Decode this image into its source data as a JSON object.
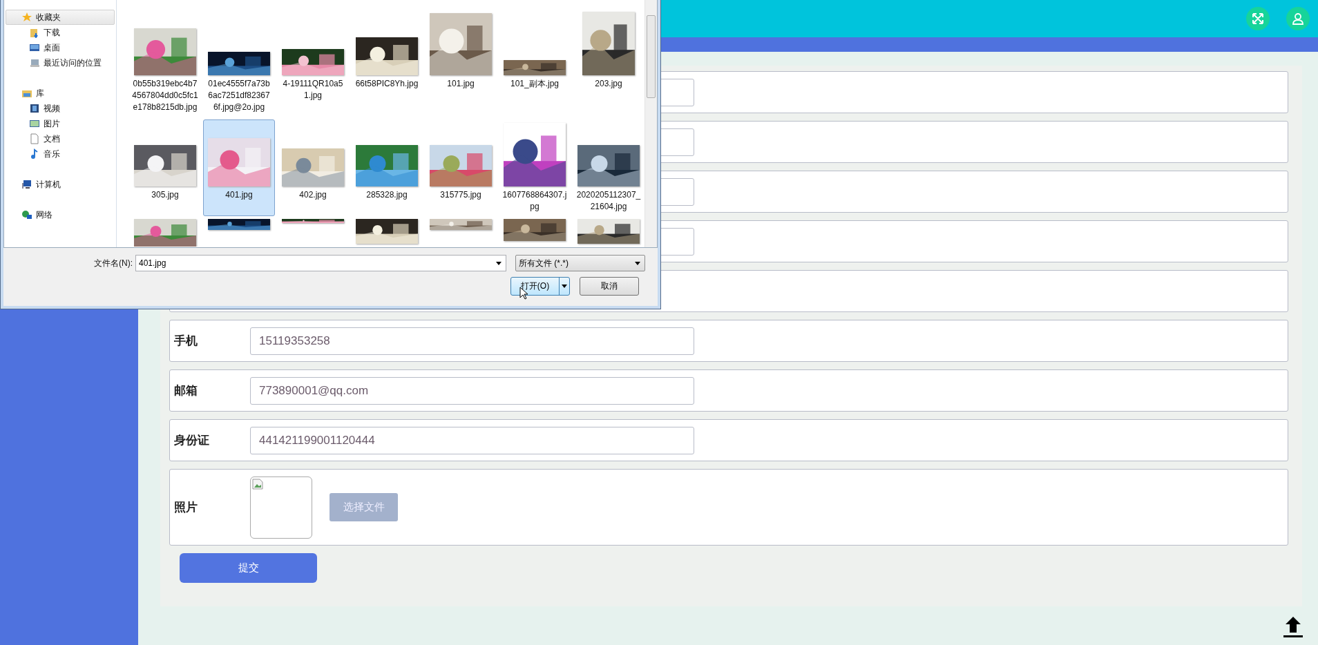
{
  "header": {
    "buttons": [
      {
        "kind": "fullscreen"
      },
      {
        "kind": "user"
      }
    ]
  },
  "form": {
    "rows": [
      {
        "kind": "input"
      },
      {
        "kind": "input"
      },
      {
        "kind": "input"
      },
      {
        "kind": "input"
      },
      {
        "kind": "blank"
      },
      {
        "kind": "input",
        "label": "手机",
        "value": "15119353258"
      },
      {
        "kind": "input",
        "label": "邮箱",
        "value": "773890001@qq.com"
      },
      {
        "kind": "input",
        "label": "身份证",
        "value": "441421199001120444"
      },
      {
        "label": "照片",
        "button": "选择文件"
      }
    ],
    "submit": "提交"
  },
  "dialog": {
    "nav": [
      {
        "label": "收藏夹",
        "selected": true,
        "children": [
          {
            "label": "下载",
            "selected": false
          },
          {
            "label": "桌面",
            "selected": false
          },
          {
            "label": "最近访问的位置",
            "selected": false
          }
        ]
      },
      {
        "label": "库",
        "selected": false,
        "children": [
          {
            "label": "视频",
            "selected": false
          },
          {
            "label": "图片",
            "selected": false
          },
          {
            "label": "文档",
            "selected": false
          },
          {
            "label": "音乐",
            "selected": false
          }
        ]
      },
      {
        "label": "计算机",
        "selected": false
      },
      {
        "label": "网络",
        "selected": false
      }
    ],
    "files": [
      {
        "name": "0b55b319ebc4b74567804dd0c5fc1e178b8215db.jpg",
        "selected": false
      },
      {
        "name": "01ec4555f7a73b6ac7251df823676f.jpg@2o.jpg",
        "selected": false
      },
      {
        "name": "4-19111QR10a51.jpg",
        "selected": false
      },
      {
        "name": "66t58PIC8Yh.jpg",
        "selected": false
      },
      {
        "name": "101.jpg",
        "selected": false
      },
      {
        "name": "101_副本.jpg",
        "selected": false
      },
      {
        "name": "203.jpg",
        "selected": false
      },
      {
        "name": "305.jpg",
        "selected": false
      },
      {
        "name": "401.jpg",
        "selected": true
      },
      {
        "name": "402.jpg",
        "selected": false
      },
      {
        "name": "285328.jpg",
        "selected": false
      },
      {
        "name": "315775.jpg",
        "selected": false
      },
      {
        "name": "1607768864307.jpg",
        "selected": false
      },
      {
        "name": "2020205112307_21604.jpg",
        "selected": false
      },
      {
        "kind": "picture"
      },
      {
        "kind": "picture"
      },
      {
        "kind": "picture"
      },
      {
        "kind": "picture"
      },
      {
        "kind": "picture"
      },
      {
        "kind": "picture"
      },
      {
        "kind": "picture"
      }
    ],
    "filename_label": "文件名(N):",
    "filename": "401.jpg",
    "filter": "所有文件 (*.*)",
    "open": "打开(O)",
    "cancel": "取消"
  }
}
